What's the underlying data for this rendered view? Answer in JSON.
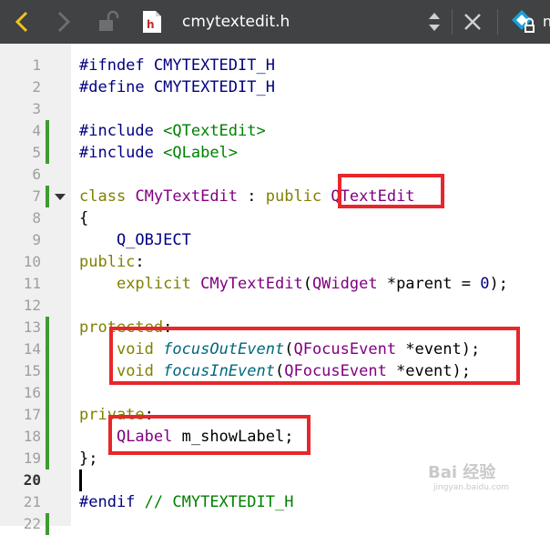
{
  "toolbar": {
    "filename": "cmytextedit.h",
    "trailing_text": "n"
  },
  "editor": {
    "lines": [
      {
        "num": "1",
        "parts": [
          {
            "t": "#ifndef",
            "c": "pp"
          },
          {
            "t": " CMYTEXTEDIT_H",
            "c": "pp"
          }
        ]
      },
      {
        "num": "2",
        "parts": [
          {
            "t": "#define",
            "c": "pp"
          },
          {
            "t": " CMYTEXTEDIT_H",
            "c": "pp"
          }
        ]
      },
      {
        "num": "3",
        "parts": []
      },
      {
        "num": "4",
        "parts": [
          {
            "t": "#include",
            "c": "pp"
          },
          {
            "t": " "
          },
          {
            "t": "<QTextEdit>",
            "c": "str"
          }
        ]
      },
      {
        "num": "5",
        "parts": [
          {
            "t": "#include",
            "c": "pp"
          },
          {
            "t": " "
          },
          {
            "t": "<QLabel>",
            "c": "str"
          }
        ]
      },
      {
        "num": "6",
        "parts": []
      },
      {
        "num": "7",
        "parts": [
          {
            "t": "class",
            "c": "kw"
          },
          {
            "t": " "
          },
          {
            "t": "CMyTextEdit",
            "c": "cls"
          },
          {
            "t": " : "
          },
          {
            "t": "public",
            "c": "kw"
          },
          {
            "t": " "
          },
          {
            "t": "QTextEdit",
            "c": "cls"
          }
        ]
      },
      {
        "num": "8",
        "parts": [
          {
            "t": "{"
          }
        ]
      },
      {
        "num": "9",
        "parts": [
          {
            "t": "    Q_OBJECT",
            "c": "pp"
          }
        ]
      },
      {
        "num": "10",
        "parts": [
          {
            "t": "public",
            "c": "kw"
          },
          {
            "t": ":"
          }
        ]
      },
      {
        "num": "11",
        "parts": [
          {
            "t": "    "
          },
          {
            "t": "explicit",
            "c": "kw"
          },
          {
            "t": " "
          },
          {
            "t": "CMyTextEdit",
            "c": "cls"
          },
          {
            "t": "("
          },
          {
            "t": "QWidget",
            "c": "cls"
          },
          {
            "t": " *parent = "
          },
          {
            "t": "0",
            "c": "num"
          },
          {
            "t": ");"
          }
        ]
      },
      {
        "num": "12",
        "parts": []
      },
      {
        "num": "13",
        "parts": [
          {
            "t": "protected",
            "c": "kw"
          },
          {
            "t": ":"
          }
        ]
      },
      {
        "num": "14",
        "parts": [
          {
            "t": "    "
          },
          {
            "t": "void",
            "c": "kw"
          },
          {
            "t": " "
          },
          {
            "t": "focusOutEvent",
            "c": "it"
          },
          {
            "t": "("
          },
          {
            "t": "QFocusEvent",
            "c": "cls"
          },
          {
            "t": " *event);"
          }
        ]
      },
      {
        "num": "15",
        "parts": [
          {
            "t": "    "
          },
          {
            "t": "void",
            "c": "kw"
          },
          {
            "t": " "
          },
          {
            "t": "focusInEvent",
            "c": "it"
          },
          {
            "t": "("
          },
          {
            "t": "QFocusEvent",
            "c": "cls"
          },
          {
            "t": " *event);"
          }
        ]
      },
      {
        "num": "16",
        "parts": []
      },
      {
        "num": "17",
        "parts": [
          {
            "t": "private",
            "c": "kw"
          },
          {
            "t": ":"
          }
        ]
      },
      {
        "num": "18",
        "parts": [
          {
            "t": "    "
          },
          {
            "t": "QLabel",
            "c": "cls"
          },
          {
            "t": " m_showLabel;"
          }
        ]
      },
      {
        "num": "19",
        "parts": [
          {
            "t": "};"
          }
        ]
      },
      {
        "num": "20",
        "parts": []
      },
      {
        "num": "21",
        "parts": [
          {
            "t": "#endif",
            "c": "pp"
          },
          {
            "t": " "
          },
          {
            "t": "// CMYTEXTEDIT_H",
            "c": "cmt"
          }
        ]
      },
      {
        "num": "22",
        "parts": []
      }
    ],
    "modified_lines": [
      "4",
      "5",
      "7",
      "13",
      "14",
      "15",
      "16",
      "17",
      "18",
      "19",
      "22"
    ],
    "fold_line": "7",
    "current_line": "20"
  },
  "watermark": {
    "text": "Bai 经验",
    "sub": "jingyan.baidu.com"
  },
  "colors": {
    "toolbar": "#404244",
    "gutter": "#f0f0f0",
    "modified_marker": "#3c9d2f",
    "highlight_box": "#e8262b"
  }
}
